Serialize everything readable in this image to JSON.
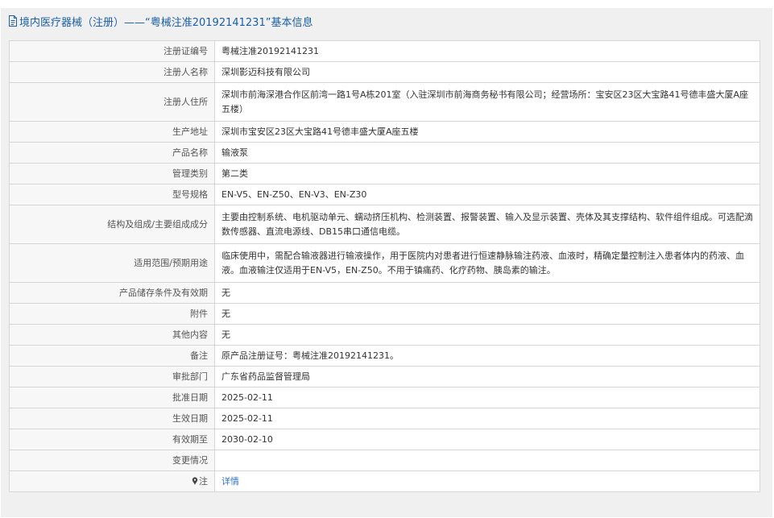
{
  "header": {
    "title": "境内医疗器械（注册）——“粤械注准20192141231”基本信息",
    "icon": "document-icon"
  },
  "colors": {
    "header_text": "#1a5fa8",
    "link": "#2f74c9",
    "panel_bg": "#f0f0f0",
    "border": "#d6d6d6"
  },
  "rows": [
    {
      "label": "注册证编号",
      "value": "粤械注准20192141231"
    },
    {
      "label": "注册人名称",
      "value": "深圳影迈科技有限公司"
    },
    {
      "label": "注册人住所",
      "value": "深圳市前海深港合作区前湾一路1号A栋201室（入驻深圳市前海商务秘书有限公司；经营场所：宝安区23区大宝路41号德丰盛大厦A座五楼）"
    },
    {
      "label": "生产地址",
      "value": "深圳市宝安区23区大宝路41号德丰盛大厦A座五楼"
    },
    {
      "label": "产品名称",
      "value": "输液泵"
    },
    {
      "label": "管理类别",
      "value": "第二类"
    },
    {
      "label": "型号规格",
      "value": "EN-V5、EN-Z50、EN-V3、EN-Z30"
    },
    {
      "label": "结构及组成/主要组成成分",
      "value": "主要由控制系统、电机驱动单元、蠕动挤压机构、检测装置、报警装置、输入及显示装置、壳体及其支撑结构、软件组件组成。可选配滴数传感器、直流电源线、DB15串口通信电缆。"
    },
    {
      "label": "适用范围/预期用途",
      "value": "临床使用中，需配合输液器进行输液操作，用于医院内对患者进行恒速静脉输注药液、血液时，精确定量控制注入患者体内的药液、血液。血液输注仅适用于EN-V5，EN-Z50。不用于镇痛药、化疗药物、胰岛素的输注。"
    },
    {
      "label": "产品储存条件及有效期",
      "value": "无"
    },
    {
      "label": "附件",
      "value": "无"
    },
    {
      "label": "其他内容",
      "value": "无"
    },
    {
      "label": "备注",
      "value": "原产品注册证号：粤械注准20192141231。"
    },
    {
      "label": "审批部门",
      "value": "广东省药品监督管理局"
    },
    {
      "label": "批准日期",
      "value": "2025-02-11"
    },
    {
      "label": "生效日期",
      "value": "2025-02-11"
    },
    {
      "label": "有效期至",
      "value": "2030-02-10"
    },
    {
      "label": "变更情况",
      "value": ""
    }
  ],
  "note_row": {
    "icon": "pin-icon",
    "label": "注",
    "link_text": "详情"
  }
}
